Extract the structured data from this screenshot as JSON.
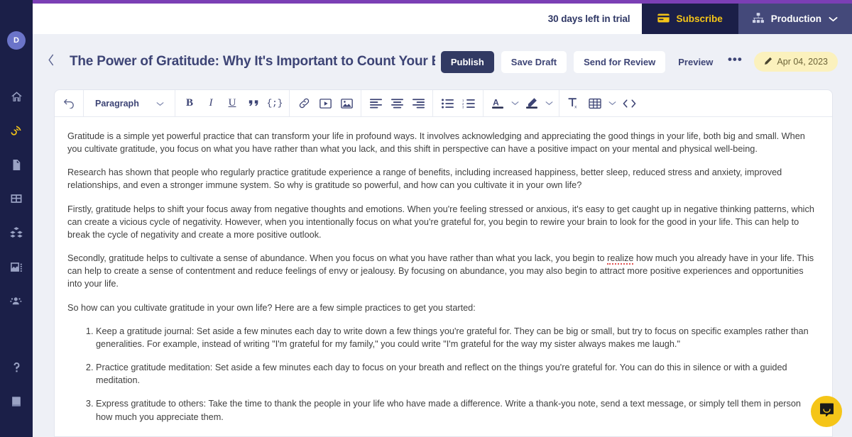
{
  "brand": {
    "accent_purple": "#7b3fb5",
    "rail_bg": "#1b1f48",
    "subscribe_yellow": "#f5c518",
    "publish_navy": "#323a63"
  },
  "rail": {
    "avatar_initial": "D",
    "items": [
      {
        "icon": "home-icon",
        "label": "Home"
      },
      {
        "icon": "blog-icon",
        "label": "Blog"
      },
      {
        "icon": "pages-icon",
        "label": "Pages"
      },
      {
        "icon": "collections-icon",
        "label": "Collections"
      },
      {
        "icon": "components-icon",
        "label": "Components"
      },
      {
        "icon": "media-icon",
        "label": "Media"
      },
      {
        "icon": "audience-icon",
        "label": "Audience"
      }
    ],
    "bottom_items": [
      {
        "icon": "help-icon",
        "label": "Help"
      },
      {
        "icon": "docs-icon",
        "label": "Docs"
      }
    ]
  },
  "topbar": {
    "trial_text": "30 days left in trial",
    "subscribe_label": "Subscribe",
    "subscribe_icon": "credit-card-icon",
    "environment_label": "Production",
    "environment_icon": "sitemap-icon",
    "environment_caret": "chevron-down-icon"
  },
  "header": {
    "back_icon": "chevron-left-icon",
    "title": "The Power of Gratitude: Why It's Important to Count Your Blessings",
    "actions": {
      "publish": "Publish",
      "save_draft": "Save Draft",
      "send_for_review": "Send for Review",
      "preview": "Preview",
      "more": "•••"
    },
    "date_pill": {
      "icon": "pencil-icon",
      "label": "Apr 04, 2023"
    }
  },
  "toolbar": {
    "undo": "undo-icon",
    "block_style": "Paragraph",
    "block_style_caret": "chevron-down-icon",
    "groups": [
      [
        "bold-icon",
        "italic-icon",
        "underline-icon",
        "blockquote-icon",
        "inline-code-icon"
      ],
      [
        "link-icon",
        "video-icon",
        "image-icon"
      ],
      [
        "align-left-icon",
        "align-center-icon",
        "align-right-icon"
      ],
      [
        "bullet-list-icon",
        "numbered-list-icon"
      ],
      [
        "text-color-icon",
        "chevron-down-icon",
        "highlight-color-icon",
        "chevron-down-icon"
      ],
      [
        "clear-formatting-icon",
        "table-icon",
        "chevron-down-icon",
        "source-code-icon"
      ]
    ]
  },
  "document": {
    "paragraphs": [
      "Gratitude is a simple yet powerful practice that can transform your life in profound ways. It involves acknowledging and appreciating the good things in your life, both big and small. When you cultivate gratitude, you focus on what you have rather than what you lack, and this shift in perspective can have a positive impact on your mental and physical well-being.",
      "Research has shown that people who regularly practice gratitude experience a range of benefits, including increased happiness, better sleep, reduced stress and anxiety, improved relationships, and even a stronger immune system. So why is gratitude so powerful, and how can you cultivate it in your own life?",
      "Firstly, gratitude helps to shift your focus away from negative thoughts and emotions. When you're feeling stressed or anxious, it's easy to get caught up in negative thinking patterns, which can create a vicious cycle of negativity. However, when you intentionally focus on what you're grateful for, you begin to rewire your brain to look for the good in your life. This can help to break the cycle of negativity and create a more positive outlook."
    ],
    "paragraph_with_spellcheck": {
      "before": "Secondly, gratitude helps to cultivate a sense of abundance. When you focus on what you have rather than what you lack, you begin to ",
      "misspelled": "realize",
      "after": " how much you already have in your life. This can help to create a sense of contentment and reduce feelings of envy or jealousy. By focusing on abundance, you may also begin to attract more positive experiences and opportunities into your life."
    },
    "intro_to_list": "So how can you cultivate gratitude in your own life? Here are a few simple practices to get you started:",
    "list_items": [
      "Keep a gratitude journal: Set aside a few minutes each day to write down a few things you're grateful for. They can be big or small, but try to focus on specific examples rather than generalities. For example, instead of writing \"I'm grateful for my family,\" you could write \"I'm grateful for the way my sister always makes me laugh.\"",
      "Practice gratitude meditation: Set aside a few minutes each day to focus on your breath and reflect on the things you're grateful for. You can do this in silence or with a guided meditation.",
      "Express gratitude to others: Take the time to thank the people in your life who have made a difference. Write a thank-you note, send a text message, or simply tell them in person how much you appreciate them."
    ]
  },
  "chat": {
    "icon": "chat-bubble-icon",
    "label": "Open chat"
  }
}
